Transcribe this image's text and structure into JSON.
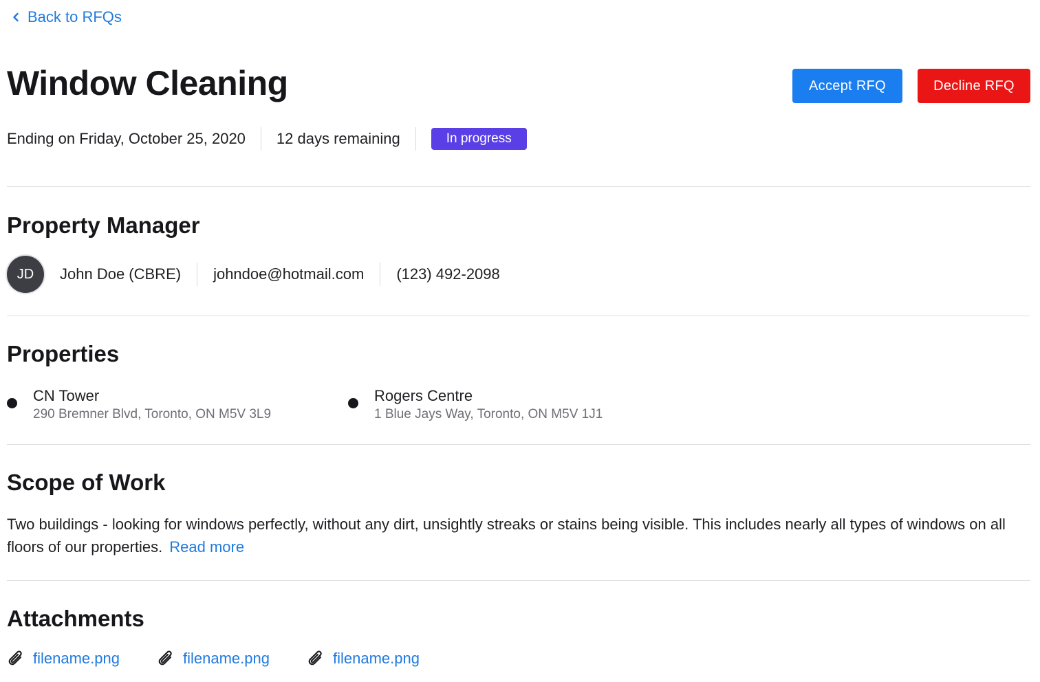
{
  "nav": {
    "back_label": "Back to RFQs",
    "back_icon": "chevron-left-icon"
  },
  "header": {
    "title": "Window Cleaning",
    "accept_label": "Accept RFQ",
    "decline_label": "Decline RFQ",
    "ending": "Ending on Friday, October 25, 2020",
    "remaining": "12 days remaining",
    "status": "In progress"
  },
  "property_manager": {
    "heading": "Property Manager",
    "initials": "JD",
    "name": "John Doe (CBRE)",
    "email": "johndoe@hotmail.com",
    "phone": "(123) 492-2098"
  },
  "properties": {
    "heading": "Properties",
    "items": [
      {
        "name": "CN Tower",
        "address": "290 Bremner Blvd, Toronto, ON M5V 3L9"
      },
      {
        "name": "Rogers Centre",
        "address": "1 Blue Jays Way, Toronto, ON M5V 1J1"
      }
    ]
  },
  "scope": {
    "heading": "Scope of Work",
    "text": "Two buildings - looking for windows perfectly, without any dirt, unsightly streaks or stains being visible.  This includes nearly all types of windows on all floors of our properties.",
    "read_more": "Read more"
  },
  "attachments": {
    "heading": "Attachments",
    "icon": "paperclip-icon",
    "files": [
      "filename.png",
      "filename.png",
      "filename.png"
    ]
  },
  "colors": {
    "link": "#1f7ae0",
    "accept": "#1a7ef0",
    "decline": "#ea1515",
    "status_badge": "#5a3ee6",
    "avatar": "#3c3e44"
  }
}
